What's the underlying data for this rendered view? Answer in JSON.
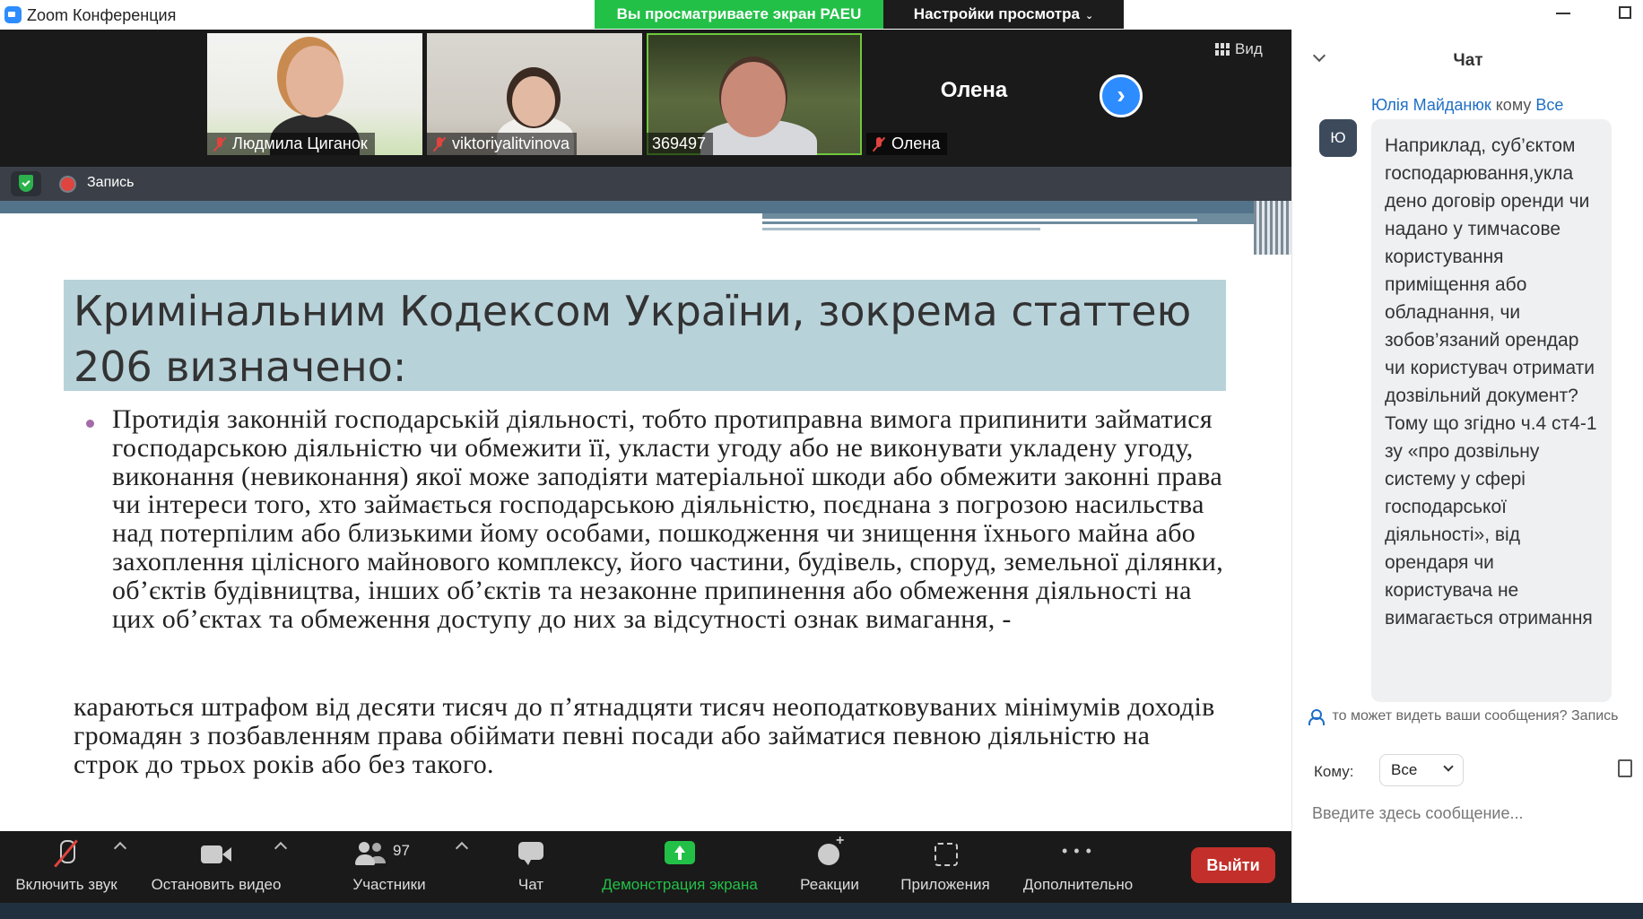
{
  "window": {
    "title": "Zoom Конференция",
    "share_banner": "Вы просматриваете экран PAEU",
    "view_settings": "Настройки просмотра"
  },
  "video": {
    "participants": [
      {
        "name": "Людмила Циганок",
        "muted": true
      },
      {
        "name": "viktoriyalitvinova",
        "muted": true
      },
      {
        "name": "369497",
        "muted": false,
        "active_speaker": true
      },
      {
        "name": "Олена",
        "muted": true,
        "video_off": true
      }
    ],
    "view_label": "Вид"
  },
  "recording": {
    "label": "Запись"
  },
  "slide": {
    "title": "Кримінальним Кодексом України, зокрема статтею 206 визначено:",
    "bullet": "Протидія законній господарській діяльності, тобто протиправна вимога припинити займатися господарською діяльністю чи обмежити її, укласти угоду або не виконувати укладену угоду, виконання (невиконання) якої може заподіяти матеріальної шкоди або обмежити законні права чи інтереси того, хто займається господарською діяльністю, поєднана з погрозою насильства над потерпілим або близькими йому особами, пошкодження чи знищення їхнього майна або захоплення цілісного майнового комплексу, його частини, будівель, споруд, земельної ділянки, об’єктів будівництва, інших об’єктів та незаконне припинення або обмеження діяльності на цих об’єктах та обмеження доступу до них за відсутності ознак вимагання, -",
    "conclusion": "караються штрафом від десяти тисяч до п’ятнадцяти тисяч неоподатковуваних мінімумів доходів громадян з позбавленням права обіймати певні посади або займатися певною діяльністю на строк до трьох років або без такого."
  },
  "toolbar": {
    "unmute": "Включить звук",
    "stop_video": "Остановить видео",
    "participants": "Участники",
    "participants_count": "97",
    "chat": "Чат",
    "share_screen": "Демонстрация экрана",
    "reactions": "Реакции",
    "apps": "Приложения",
    "more": "Дополнительно",
    "leave": "Выйти"
  },
  "chat": {
    "title": "Чат",
    "sender_name": "Юлія Майданюк",
    "to_word": "кому",
    "recipient": "Все",
    "avatar_letter": "Ю",
    "message": "Наприклад, суб’єктом господарювання,укла дено договір оренди чи надано у тимчасове користування приміщення або обладнання, чи зобов’язаний орендар чи користувач отримати дозвільний документ?\nТому що згідно ч.4 ст4-1 зу «про дозвільну систему у сфері господарської діяльності», від орендаря чи користувача не вимагається отримання",
    "visibility_notice": "то может видеть ваши сообщения? Запись",
    "to_label": "Кому:",
    "to_value": "Все",
    "input_placeholder": "Введите здесь сообщение..."
  },
  "colors": {
    "share_green": "#23c048",
    "leave_red": "#c32f2a",
    "zoom_blue": "#2d8cff",
    "slide_title_bg": "#b8d2da"
  }
}
